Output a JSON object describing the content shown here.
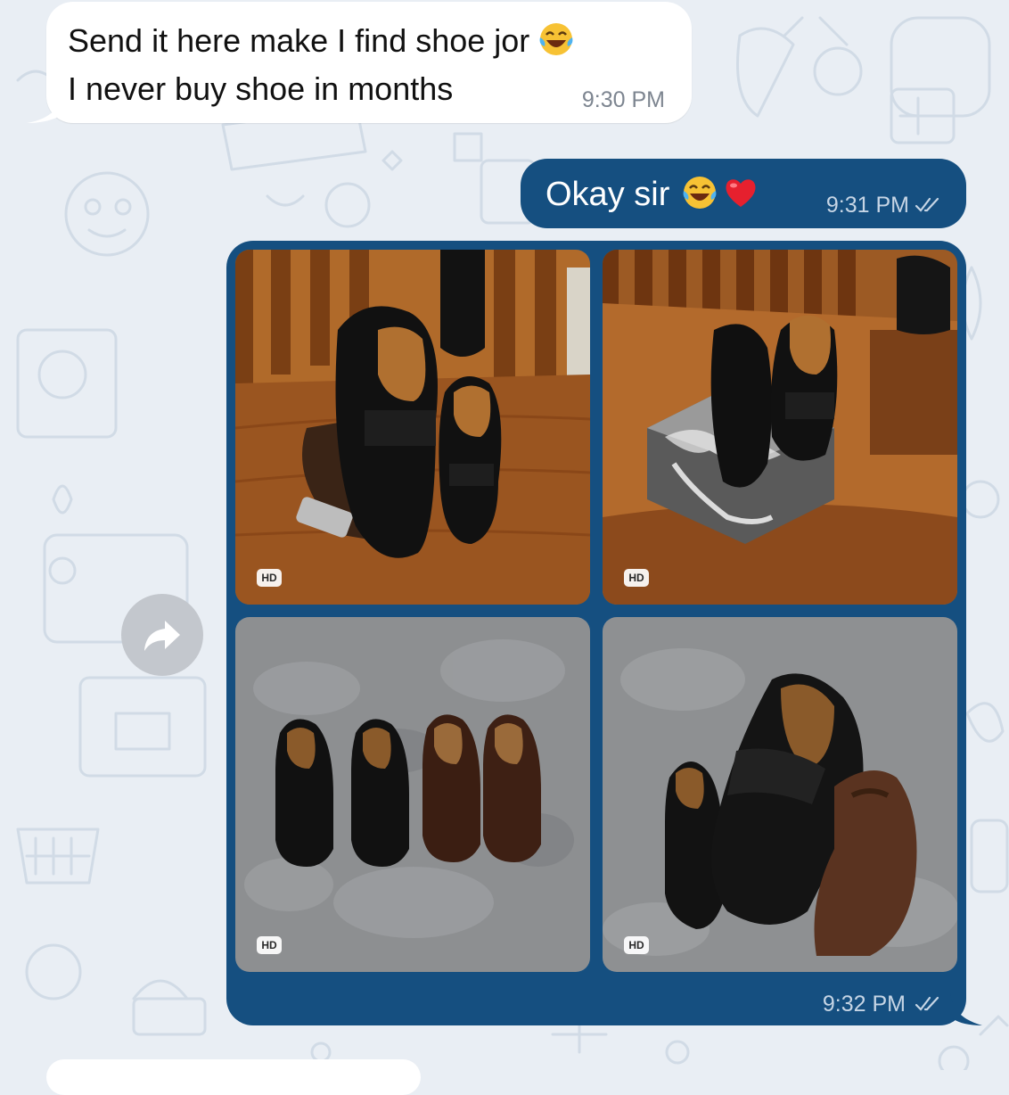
{
  "incoming_message": {
    "line1": "Send it here make I find shoe jor",
    "line2": "I never buy shoe in months",
    "time": "9:30 PM",
    "emoji": "laughing-tears-icon"
  },
  "outgoing_message": {
    "text": "Okay sir",
    "time": "9:31 PM",
    "emojis": [
      "laughing-tears-icon",
      "red-heart-icon"
    ],
    "status": "read"
  },
  "album": {
    "time": "9:32 PM",
    "status": "read",
    "photos": [
      {
        "badge": "HD",
        "subject": "black penny loafers held in hand on wooden table"
      },
      {
        "badge": "HD",
        "subject": "black loafers on marble box"
      },
      {
        "badge": "HD",
        "subject": "four loafers black and brown on concrete"
      },
      {
        "badge": "HD",
        "subject": "black loafer held in hand on concrete"
      }
    ]
  },
  "forward_button": {
    "icon": "forward-arrow-icon"
  },
  "colors": {
    "background": "#e9eef4",
    "outgoing_bubble": "#154f80",
    "incoming_bubble": "#ffffff",
    "timestamp_outgoing": "#c6d5e5",
    "timestamp_incoming": "#7d8590"
  }
}
